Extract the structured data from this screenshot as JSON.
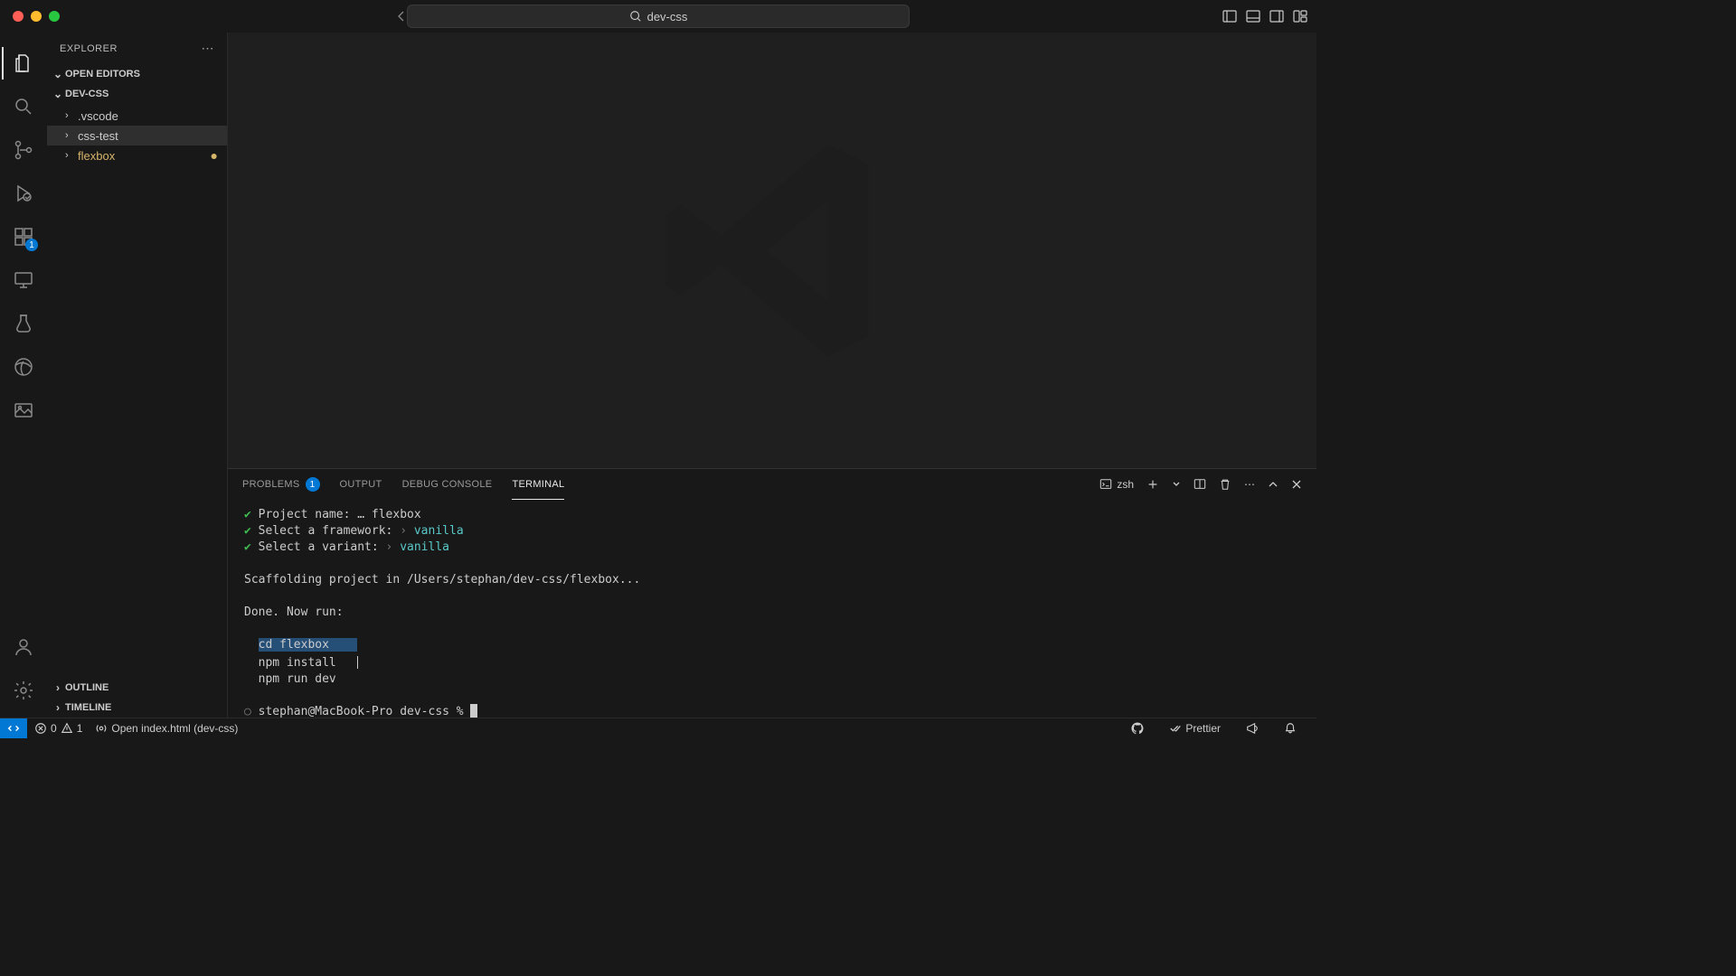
{
  "titlebar": {
    "search_text": "dev-css"
  },
  "sidebar": {
    "title": "EXPLORER",
    "open_editors": "OPEN EDITORS",
    "root_folder": "DEV-CSS",
    "tree": [
      {
        "name": ".vscode",
        "selected": false,
        "modified": false
      },
      {
        "name": "css-test",
        "selected": true,
        "modified": false
      },
      {
        "name": "flexbox",
        "selected": false,
        "modified": true
      }
    ],
    "outline": "OUTLINE",
    "timeline": "TIMELINE"
  },
  "activity": {
    "extensions_badge": "1"
  },
  "panel": {
    "tabs": {
      "problems": "PROBLEMS",
      "problems_badge": "1",
      "output": "OUTPUT",
      "debug": "DEBUG CONSOLE",
      "terminal": "TERMINAL"
    },
    "shell": "zsh"
  },
  "terminal": {
    "line1_label": "Project name:",
    "line1_sep": "…",
    "line1_value": "flexbox",
    "line2_label": "Select a framework:",
    "line2_value": "vanilla",
    "line3_label": "Select a variant:",
    "line3_value": "vanilla",
    "scaffold": "Scaffolding project in /Users/stephan/dev-css/flexbox...",
    "done": "Done. Now run:",
    "cmd1": "cd flexbox",
    "cmd2": "npm install",
    "cmd3": "npm run dev",
    "prompt": "stephan@MacBook-Pro dev-css % "
  },
  "statusbar": {
    "errors": "0",
    "warnings": "1",
    "live": "Open index.html (dev-css)",
    "prettier": "Prettier"
  }
}
